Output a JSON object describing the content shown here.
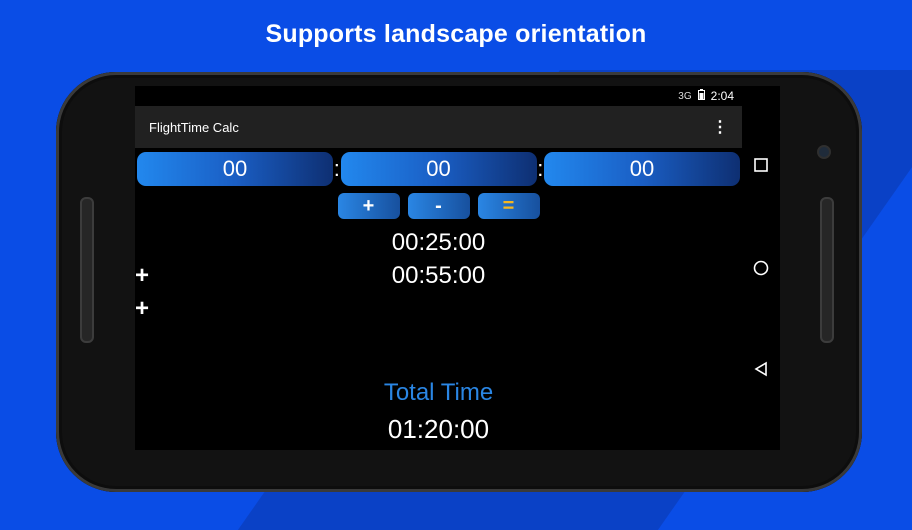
{
  "headline": "Supports landscape orientation",
  "statusbar": {
    "network": "3G",
    "battery_icon": "battery-icon",
    "time": "2:04"
  },
  "appbar": {
    "title": "FlightTime Calc",
    "menu_icon": "⋮"
  },
  "inputs": {
    "hours": "00",
    "minutes": "00",
    "seconds": "00",
    "separator": ":"
  },
  "operators": {
    "plus": "+",
    "minus": "-",
    "equals": "="
  },
  "entries": [
    {
      "operator": "",
      "value": "00:25:00"
    },
    {
      "operator": "+",
      "value": "00:55:00"
    },
    {
      "operator": "+",
      "value": ""
    }
  ],
  "total": {
    "label": "Total Time",
    "value": "01:20:00"
  },
  "colors": {
    "background": "#0a4de6",
    "accent_blue": "#2a86e4",
    "equals_orange": "#f5b720"
  }
}
